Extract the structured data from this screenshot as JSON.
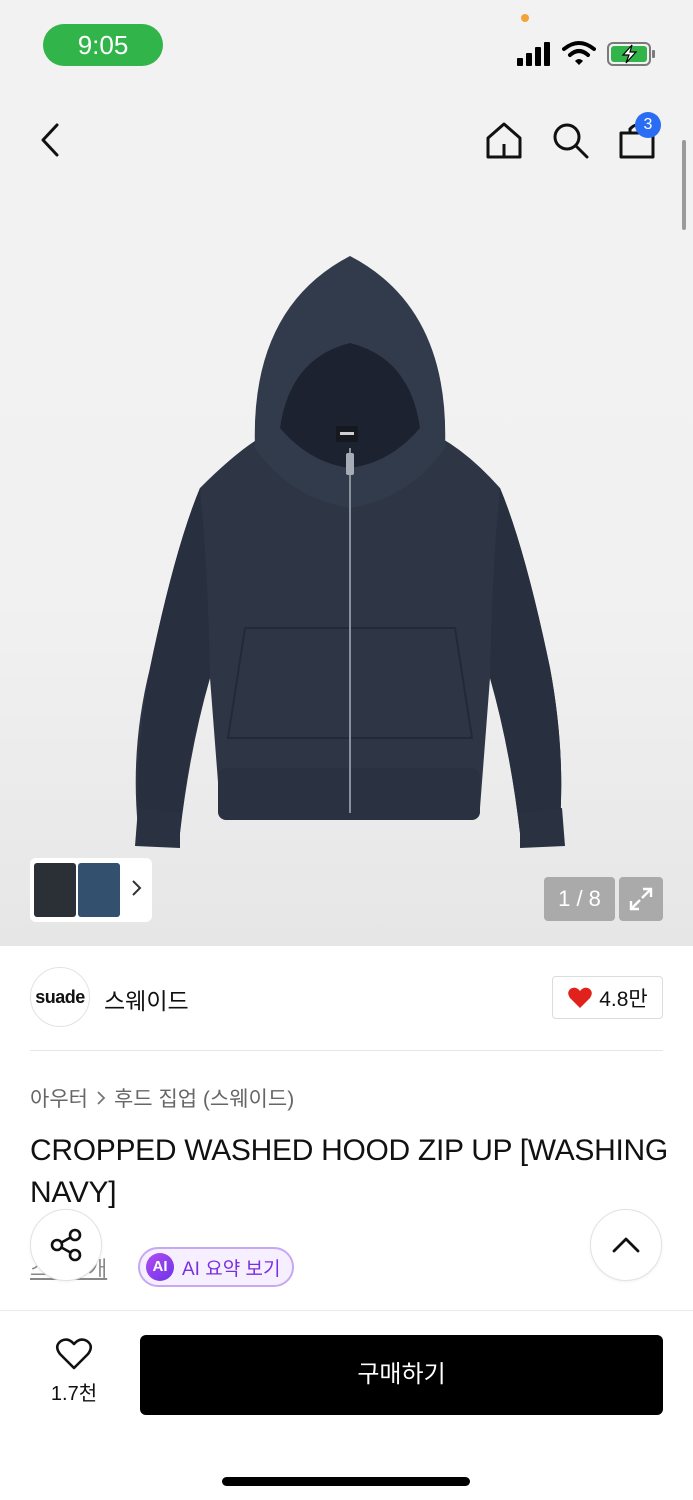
{
  "status_bar": {
    "time": "9:05",
    "cart_count": "3"
  },
  "gallery": {
    "counter": "1 / 8"
  },
  "brand": {
    "logo_text": "suade",
    "name": "스웨이드",
    "likes": "4.8만"
  },
  "breadcrumb": {
    "category": "아우터",
    "subcategory": "후드 집업 (스웨이드)"
  },
  "product": {
    "title": "CROPPED WASHED HOOD ZIP UP [WASHING NAVY]"
  },
  "reviews": {
    "link_text": "스 …4개"
  },
  "ai_summary": {
    "badge": "AI",
    "label": "AI 요약 보기"
  },
  "bottom_bar": {
    "wish_count": "1.7천",
    "buy_label": "구매하기"
  },
  "colors": {
    "accent_blue": "#2a6df4",
    "status_green": "#31b44a",
    "heart_red": "#e0211c",
    "ai_purple": "#7a2fe0"
  },
  "icons": [
    "back-icon",
    "home-icon",
    "search-icon",
    "cart-icon",
    "expand-icon",
    "heart-icon",
    "share-icon",
    "chevron-up-icon"
  ]
}
